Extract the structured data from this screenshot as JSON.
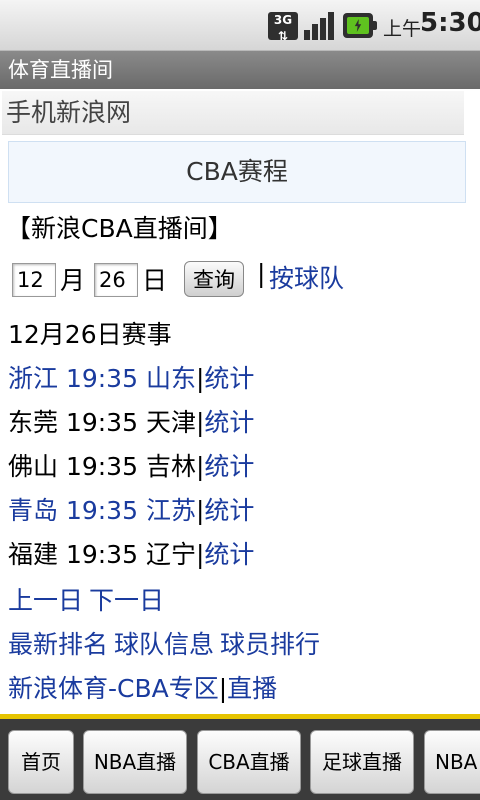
{
  "status_bar": {
    "network": "3G",
    "ampm": "上午",
    "time": "5:30",
    "icons": [
      "3g-icon",
      "signal-icon",
      "battery-charging-icon"
    ]
  },
  "app": {
    "title": "体育直播间"
  },
  "page": {
    "site_name": "手机新浪网",
    "schedule_title": "CBA赛程",
    "room_title": "【新浪CBA直播间】",
    "date_form": {
      "month_value": "12",
      "month_label": "月",
      "day_value": "26",
      "day_label": "日",
      "query_button": "查询",
      "separator": "|",
      "by_team_link": "按球队"
    },
    "list_title": "12月26日赛事",
    "games": [
      {
        "matchup": "浙江 19:35 山东",
        "linked": true,
        "stat_label": "统计"
      },
      {
        "matchup": "东莞 19:35 天津",
        "linked": false,
        "stat_label": "统计"
      },
      {
        "matchup": "佛山 19:35 吉林",
        "linked": false,
        "stat_label": "统计"
      },
      {
        "matchup": "青岛 19:35 江苏",
        "linked": true,
        "stat_label": "统计"
      },
      {
        "matchup": "福建 19:35 辽宁",
        "linked": false,
        "stat_label": "统计"
      }
    ],
    "day_nav": {
      "prev": "上一日",
      "next": "下一日"
    },
    "info_links": {
      "ranking": "最新排名",
      "team_info": "球队信息",
      "player_rank": "球员排行"
    },
    "footer_links": {
      "cba_zone": "新浪体育-CBA专区",
      "separator": "|",
      "live": "直播"
    }
  },
  "bottom_tabs": [
    "首页",
    "NBA直播",
    "CBA直播",
    "足球直播",
    "NBA"
  ],
  "colors": {
    "link": "#1a3b9e",
    "accent_bar": "#e6c400",
    "titlebar": "#777777"
  }
}
